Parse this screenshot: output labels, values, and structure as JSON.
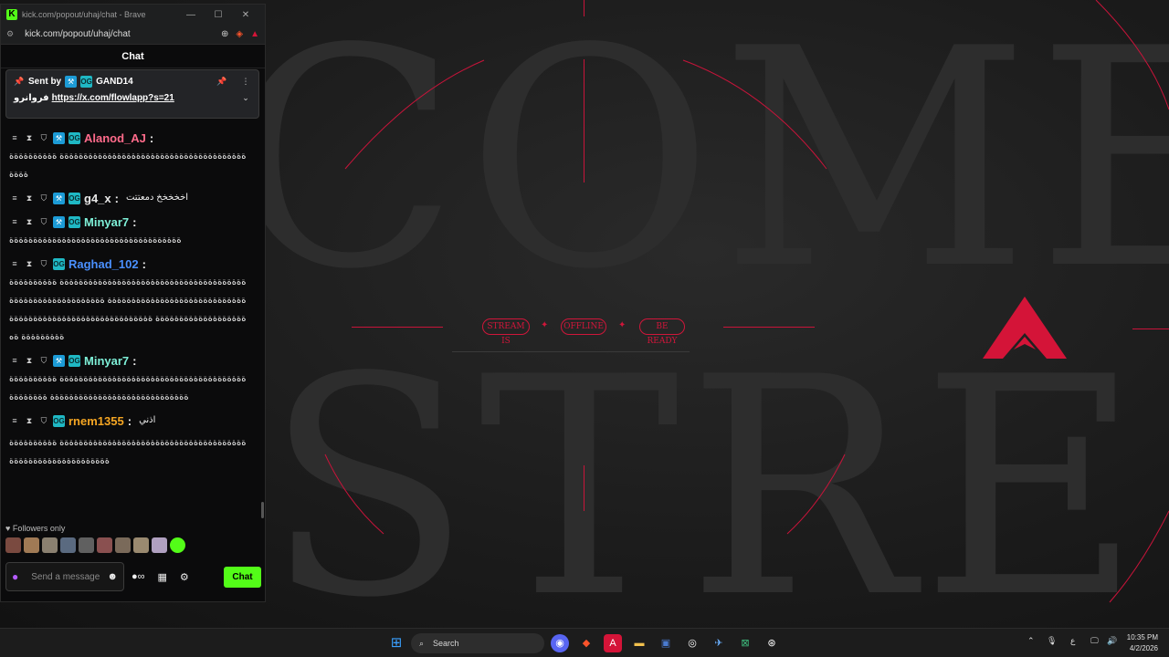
{
  "browser": {
    "title": "kick.com/popout/uhaj/chat - Brave",
    "url": "kick.com/popout/uhaj/chat"
  },
  "chat": {
    "header": "Chat",
    "pinned": {
      "sent_by_label": "Sent by",
      "author": "GAND14",
      "prefix": "فروانرو",
      "link": "https://x.com/flowlapp?s=21"
    },
    "messages": [
      {
        "user": "Alanod_AJ",
        "color": "#ff6b8b",
        "text": "ةةةةةةةةةةةةةةةةةةةةةةةةةةةةةةةةةةةةةةة ةةةةةةةةةةةةةة"
      },
      {
        "user": "g4_x",
        "color": "#e8e8e8",
        "text": "اخخخخخ دمعتتت"
      },
      {
        "user": "Minyar7",
        "color": "#7ef0d8",
        "text": "ةةةةةةةةةةةةةةةةةةةةةةةةةةةةةةةةةةةة"
      },
      {
        "user": "Raghad_102",
        "color": "#4a90ff",
        "text": "ةةةةةةةةةةةةةةةةةةةةةةةةةةةةةةةةةةةةةةة ةةةةةةةةةةةةةةةةةةةةةةةةةةةةةةةةةةةةةةة ةةةةةةةةةةةةةةةةةةةةةةةةةةةةةةةةةةةةةةة ةةةةةةةةةةةةةةةةةةةةةةةةةةةةةةةةةةةةةةة ةه"
      },
      {
        "user": "Minyar7",
        "color": "#7ef0d8",
        "text": "ةةةةةةةةةةةةةةةةةةةةةةةةةةةةةةةةةةةةةةة ةةةةةةةةةةةةةةةةةةةةةةةةةةةةةةةةةةةةةةة ةةةةةةةة"
      },
      {
        "user": "rnem1355",
        "color": "#f5a623",
        "text": "اذني"
      },
      {
        "user": "",
        "color": "#e8e8e8",
        "text": "ةةةةةةةةةةةةةةةةةةةةةةةةةةةةةةةةةةةةةةة ةةةةةةةةةةةةةةةةةةةةةةةةةةةةةةة"
      }
    ],
    "followers_only": "Followers only",
    "placeholder": "Send a message",
    "send_label": "Chat"
  },
  "background": {
    "line1": "COME",
    "line2": "STRE",
    "tags": [
      "STREAM IS",
      "OFFLINE",
      "BE READY"
    ]
  },
  "taskbar": {
    "search": "Search",
    "time": "10:35 PM",
    "date": "4/2/2026",
    "lang": "ع"
  }
}
